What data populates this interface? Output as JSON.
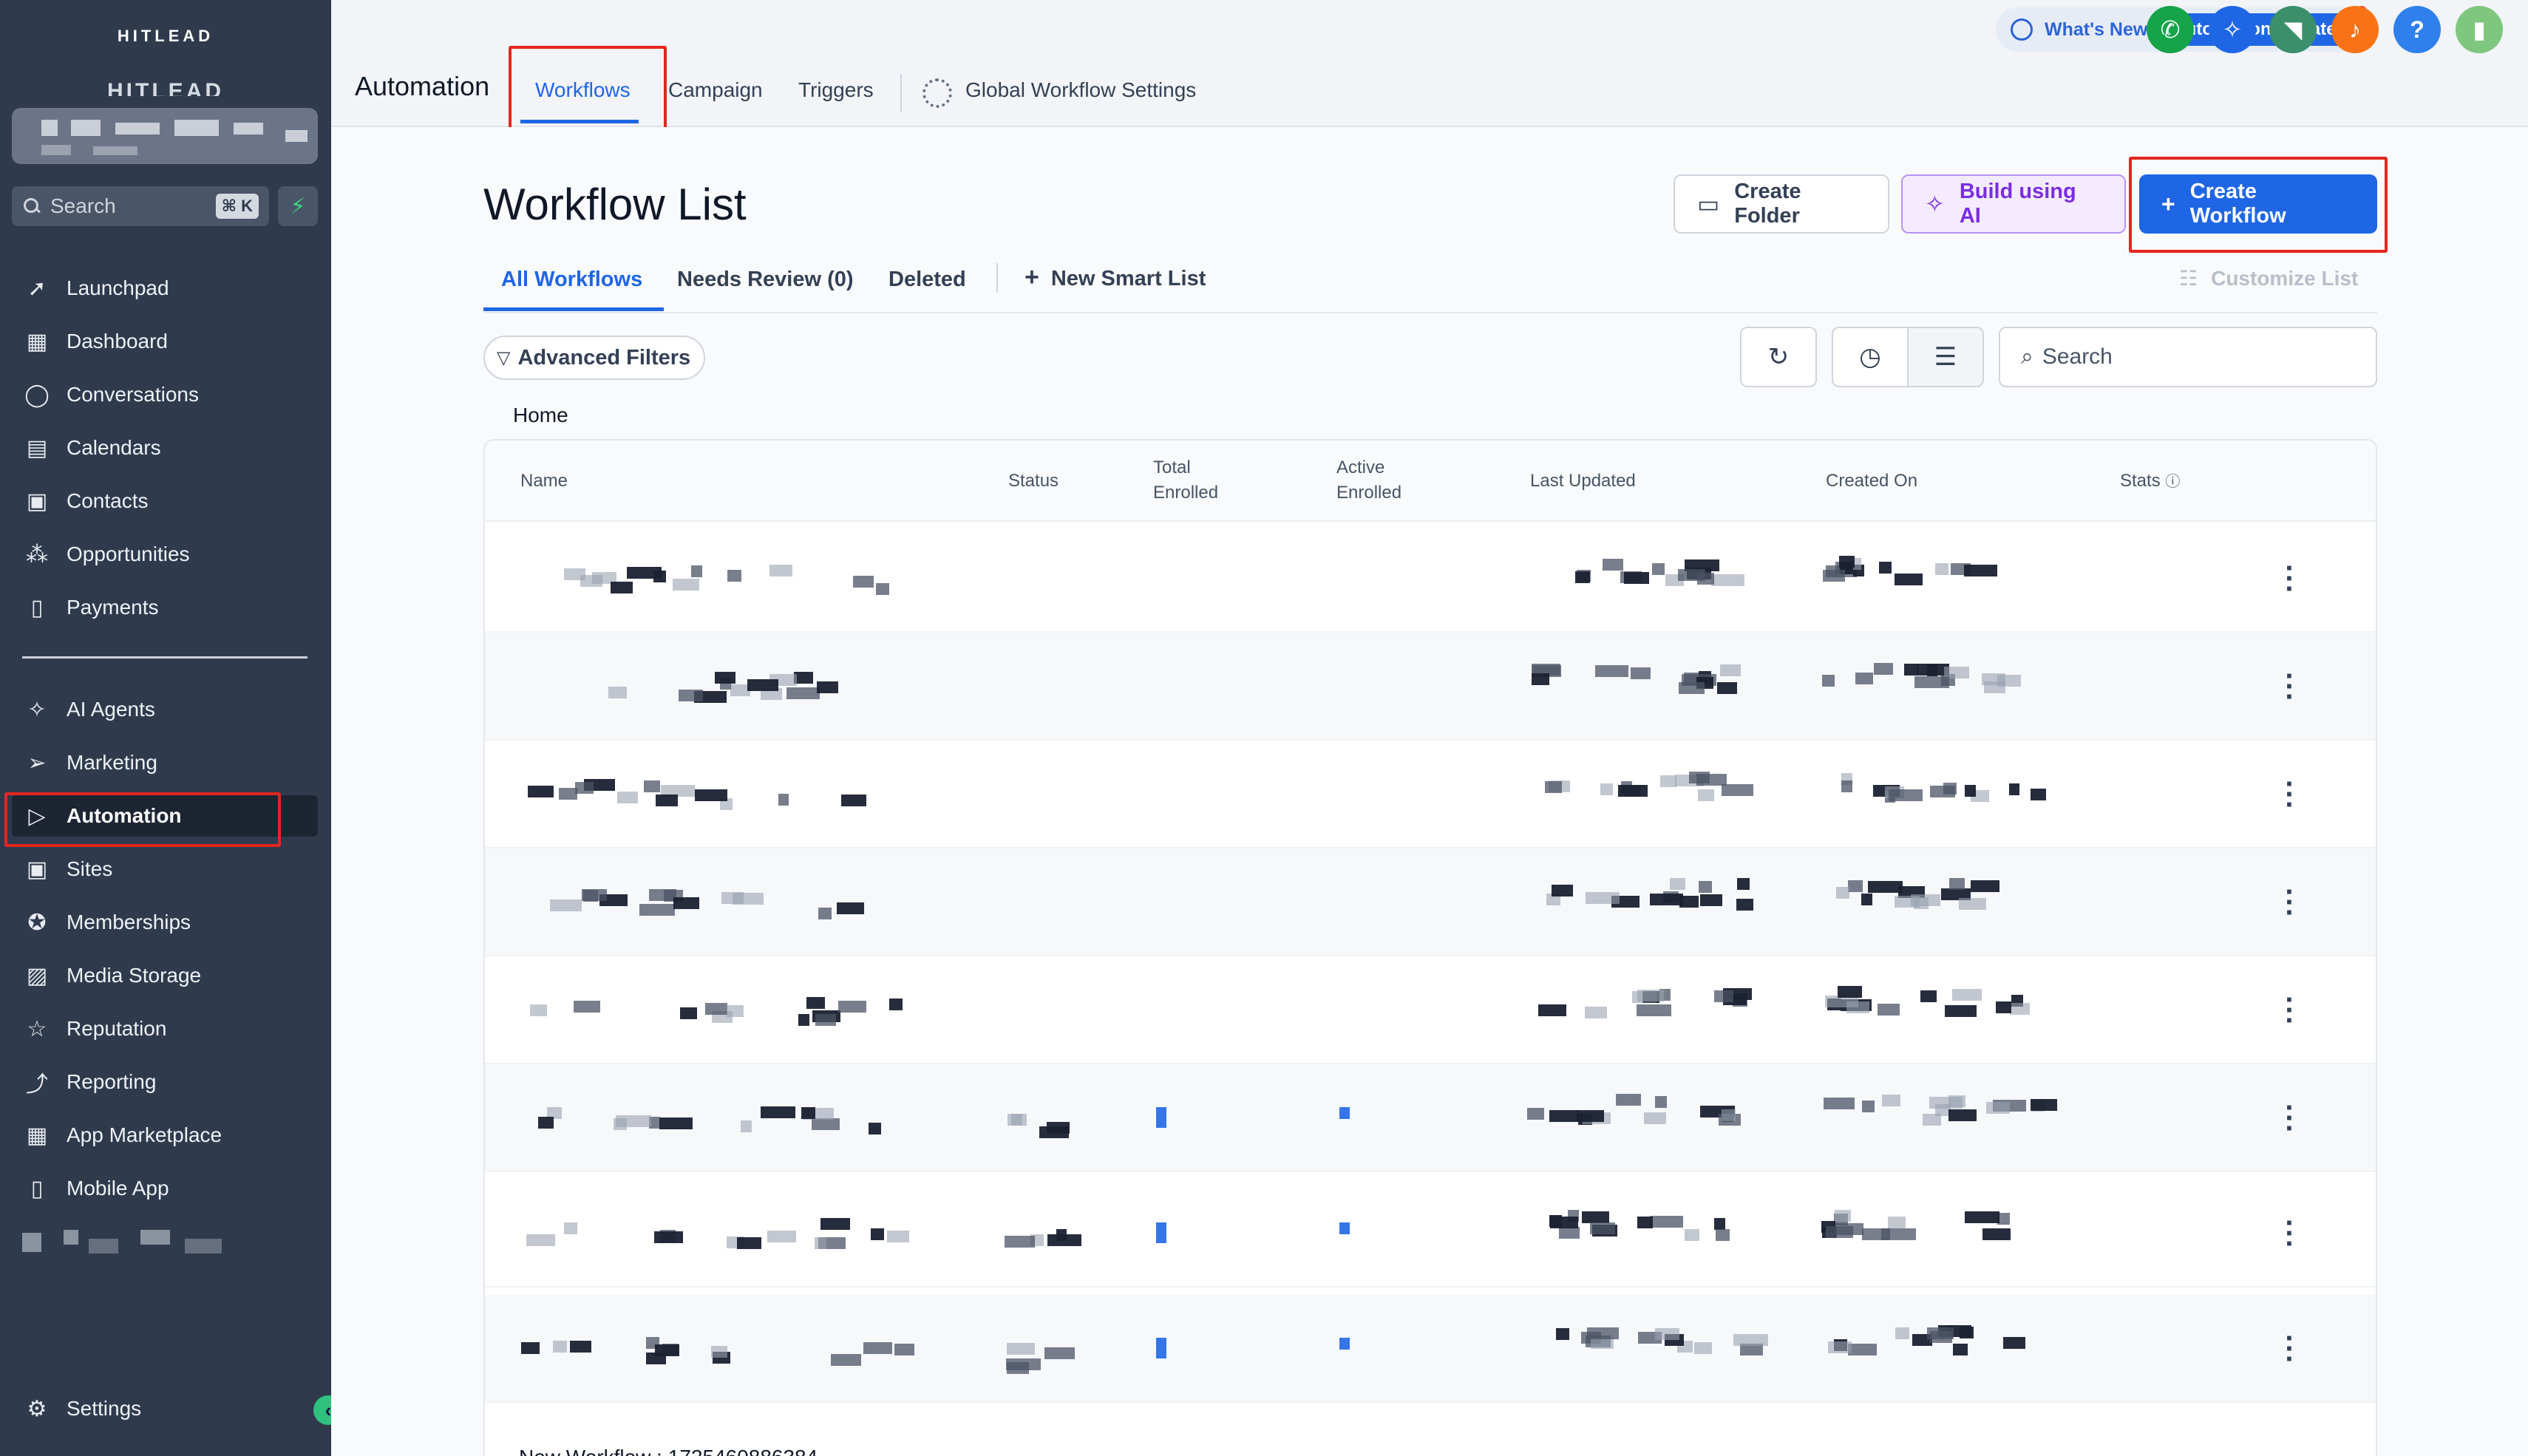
{
  "sidebar": {
    "brand": "HITLEAD",
    "brand_ghost": "HITLEAD",
    "search_label": "Search",
    "search_shortcut": "⌘ K",
    "items_top": [
      {
        "label": "Launchpad",
        "icon": "rocket-icon"
      },
      {
        "label": "Dashboard",
        "icon": "grid-icon"
      },
      {
        "label": "Conversations",
        "icon": "chat-icon"
      },
      {
        "label": "Calendars",
        "icon": "calendar-icon"
      },
      {
        "label": "Contacts",
        "icon": "contacts-icon"
      },
      {
        "label": "Opportunities",
        "icon": "funnel-icon"
      },
      {
        "label": "Payments",
        "icon": "receipt-icon"
      }
    ],
    "items_bottom": [
      {
        "label": "AI Agents",
        "icon": "sparkle-icon"
      },
      {
        "label": "Marketing",
        "icon": "send-icon"
      },
      {
        "label": "Automation",
        "icon": "play-icon",
        "active": true
      },
      {
        "label": "Sites",
        "icon": "globe-icon"
      },
      {
        "label": "Memberships",
        "icon": "badge-icon"
      },
      {
        "label": "Media Storage",
        "icon": "image-icon"
      },
      {
        "label": "Reputation",
        "icon": "star-icon"
      },
      {
        "label": "Reporting",
        "icon": "trend-icon"
      },
      {
        "label": "App Marketplace",
        "icon": "apps-icon"
      },
      {
        "label": "Mobile App",
        "icon": "phone-icon"
      }
    ],
    "settings_label": "Settings"
  },
  "topbar": {
    "whats_new": "What's New",
    "automation_updates": "Automation Updates",
    "help_glyph": "?",
    "colors": {
      "phone": "#16a34a",
      "ai": "#1f66e5",
      "announce": "#3b8f6b",
      "bell": "#f97316",
      "help": "#2f80ed",
      "avatar": "#7fc77f"
    }
  },
  "tabs": {
    "page_title": "Automation",
    "items": [
      "Workflows",
      "Campaign",
      "Triggers"
    ],
    "global_settings": "Global Workflow Settings"
  },
  "main": {
    "title": "Workflow List",
    "create_folder": "Create Folder",
    "build_ai": "Build using AI",
    "create_workflow": "Create Workflow",
    "subtabs": [
      "All Workflows",
      "Needs Review (0)",
      "Deleted"
    ],
    "new_smart_list": "New Smart List",
    "customize_list": "Customize List",
    "advanced_filters": "Advanced Filters",
    "search_placeholder": "Search",
    "breadcrumb": "Home",
    "columns": {
      "name": "Name",
      "status": "Status",
      "total_1": "Total",
      "total_2": "Enrolled",
      "active_1": "Active",
      "active_2": "Enrolled",
      "last_updated": "Last Updated",
      "created_on": "Created On",
      "stats": "Stats"
    },
    "last_row_name": "New Workflow : 1725460886384",
    "accent": "#1f66e5"
  }
}
